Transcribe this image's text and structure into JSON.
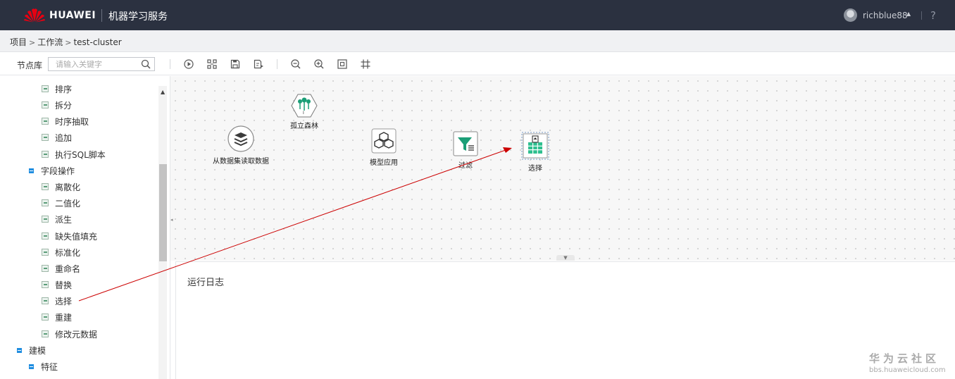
{
  "header": {
    "brand": "HUAWEI",
    "product": "机器学习服务",
    "username": "richblue88",
    "help": "?"
  },
  "breadcrumb": {
    "items": [
      "项目",
      "工作流",
      "test-cluster"
    ],
    "separator": ">"
  },
  "toolbar": {
    "library_label": "节点库",
    "search_placeholder": "请输入关键字",
    "buttons": [
      "run-icon",
      "layout-icon",
      "save-icon",
      "save-as-icon",
      "zoom-out-icon",
      "zoom-in-icon",
      "fit-screen-icon",
      "grid-icon"
    ]
  },
  "sidebar": {
    "items": [
      {
        "label": "排序",
        "kind": "leaf"
      },
      {
        "label": "拆分",
        "kind": "leaf"
      },
      {
        "label": "时序抽取",
        "kind": "leaf"
      },
      {
        "label": "追加",
        "kind": "leaf"
      },
      {
        "label": "执行SQL脚本",
        "kind": "leaf"
      },
      {
        "label": "字段操作",
        "kind": "branch"
      },
      {
        "label": "离散化",
        "kind": "leaf"
      },
      {
        "label": "二值化",
        "kind": "leaf"
      },
      {
        "label": "派生",
        "kind": "leaf"
      },
      {
        "label": "缺失值填充",
        "kind": "leaf"
      },
      {
        "label": "标准化",
        "kind": "leaf"
      },
      {
        "label": "重命名",
        "kind": "leaf"
      },
      {
        "label": "替换",
        "kind": "leaf"
      },
      {
        "label": "选择",
        "kind": "leaf"
      },
      {
        "label": "重建",
        "kind": "leaf"
      },
      {
        "label": "修改元数据",
        "kind": "leaf"
      },
      {
        "label": "建模",
        "kind": "branch"
      },
      {
        "label": "特征",
        "kind": "branch"
      }
    ]
  },
  "canvas": {
    "nodes": [
      {
        "label": "孤立森林",
        "icon": "isolation-forest-icon"
      },
      {
        "label": "从数据集读取数据",
        "icon": "dataset-read-icon"
      },
      {
        "label": "模型应用",
        "icon": "model-apply-icon"
      },
      {
        "label": "过滤",
        "icon": "filter-icon"
      },
      {
        "label": "选择",
        "icon": "select-icon"
      }
    ],
    "annotation_color": "#cc0000"
  },
  "log_panel": {
    "title": "运行日志"
  },
  "watermark": {
    "cn": "华为云社区",
    "en": "bbs.huaweicloud.com"
  }
}
